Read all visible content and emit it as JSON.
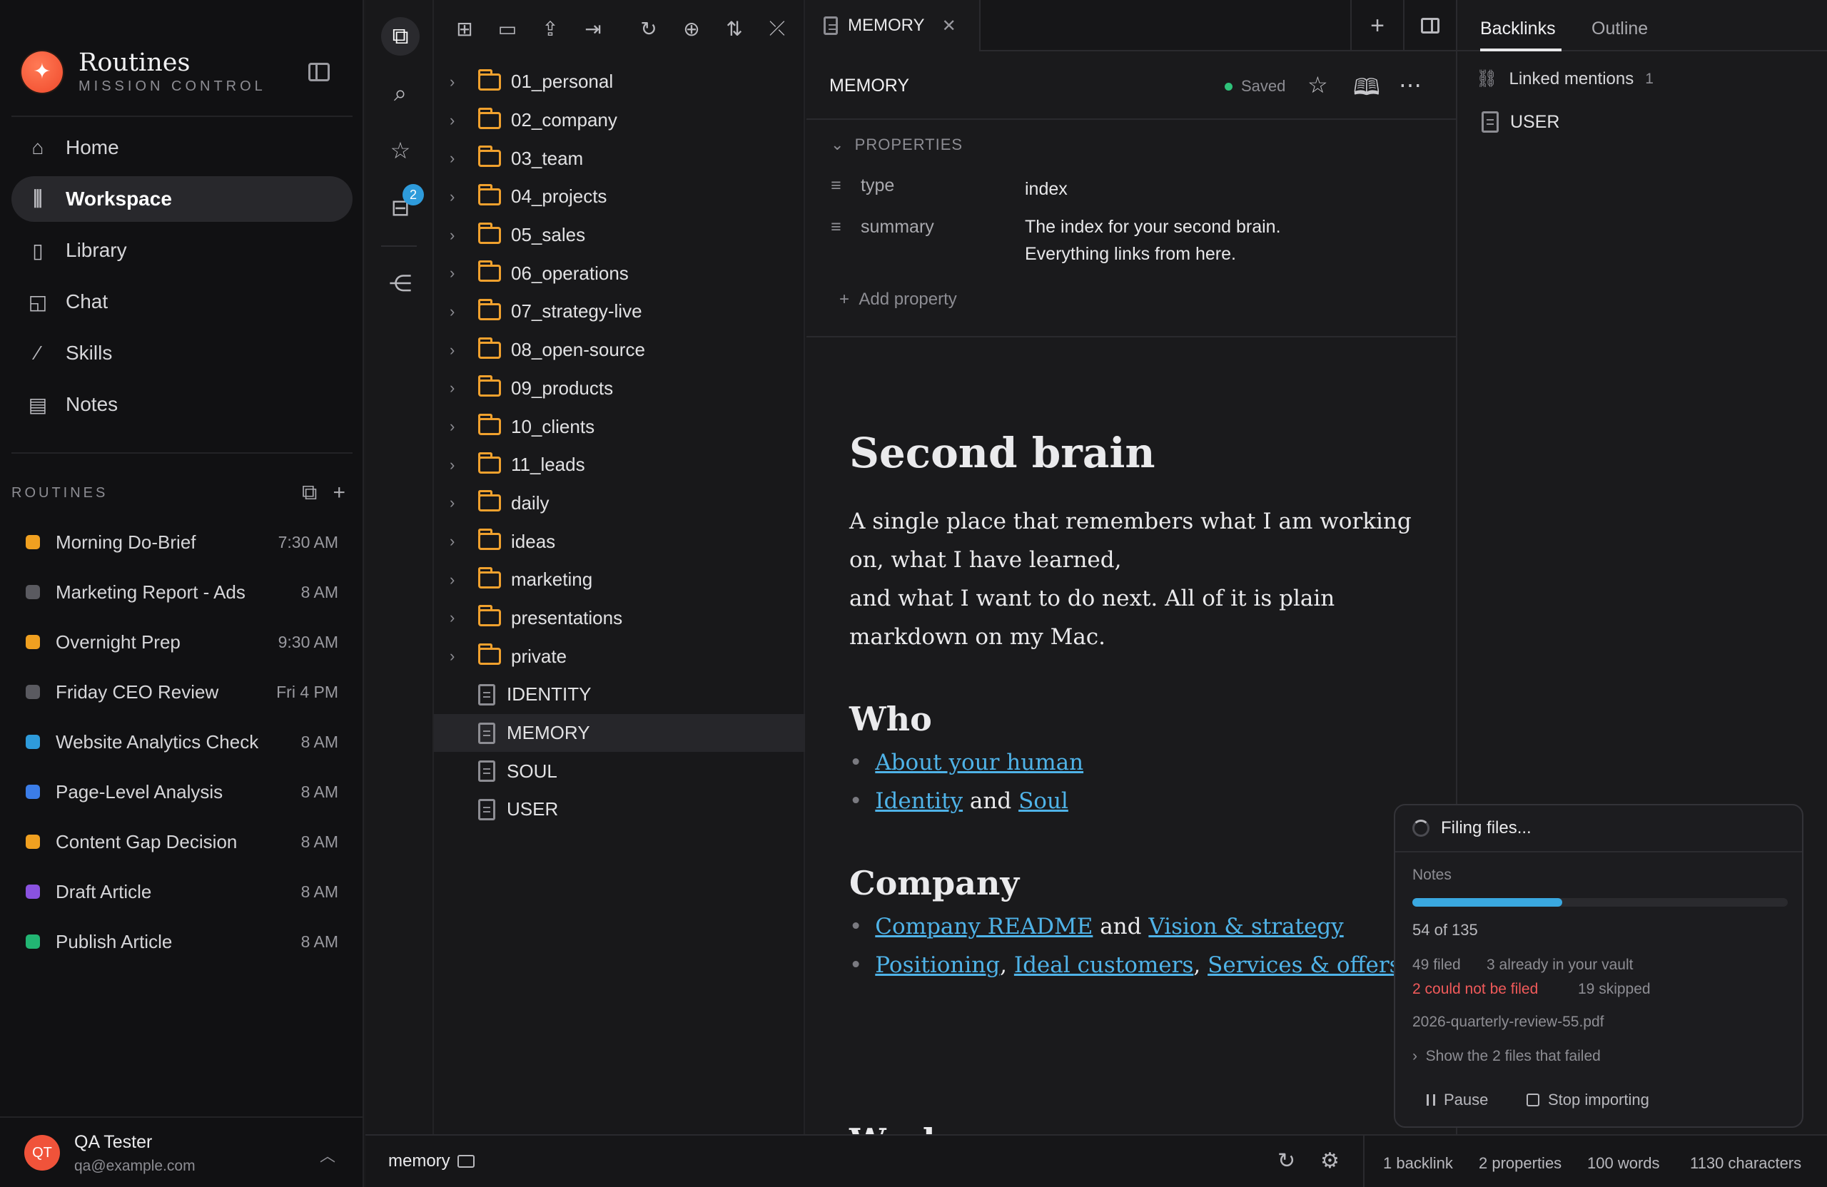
{
  "brand": {
    "title": "Routines",
    "subtitle": "MISSION CONTROL",
    "logo_icon": "sparkle-icon",
    "accent": "#f04a2c"
  },
  "nav": [
    {
      "label": "Home",
      "icon": "home-icon",
      "active": false
    },
    {
      "label": "Workspace",
      "icon": "library-icon",
      "active": true
    },
    {
      "label": "Library",
      "icon": "book-icon",
      "active": false
    },
    {
      "label": "Chat",
      "icon": "chat-icon",
      "active": false
    },
    {
      "label": "Skills",
      "icon": "wand-icon",
      "active": false
    },
    {
      "label": "Notes",
      "icon": "note-icon",
      "active": false
    }
  ],
  "routines": {
    "label": "ROUTINES",
    "items": [
      {
        "name": "Morning Do-Brief",
        "time": "7:30 AM",
        "color": "#f0a020"
      },
      {
        "name": "Marketing Report - Ads",
        "time": "8 AM",
        "color": "#5a5a60"
      },
      {
        "name": "Overnight Prep",
        "time": "9:30 AM",
        "color": "#f0a020"
      },
      {
        "name": "Friday CEO Review",
        "time": "Fri 4 PM",
        "color": "#5a5a60"
      },
      {
        "name": "Website Analytics Check",
        "time": "8 AM",
        "color": "#2e9bdb"
      },
      {
        "name": "Page-Level Analysis",
        "time": "8 AM",
        "color": "#3b7de8"
      },
      {
        "name": "Content Gap Decision",
        "time": "8 AM",
        "color": "#f0a020"
      },
      {
        "name": "Draft Article",
        "time": "8 AM",
        "color": "#8a52e0"
      },
      {
        "name": "Publish Article",
        "time": "8 AM",
        "color": "#22b573"
      }
    ]
  },
  "user": {
    "initials": "QT",
    "name": "QA Tester",
    "email": "qa@example.com"
  },
  "rail": {
    "inbox_badge": "2"
  },
  "tree": [
    {
      "name": "01_personal",
      "type": "folder"
    },
    {
      "name": "02_company",
      "type": "folder"
    },
    {
      "name": "03_team",
      "type": "folder"
    },
    {
      "name": "04_projects",
      "type": "folder"
    },
    {
      "name": "05_sales",
      "type": "folder"
    },
    {
      "name": "06_operations",
      "type": "folder"
    },
    {
      "name": "07_strategy-live",
      "type": "folder"
    },
    {
      "name": "08_open-source",
      "type": "folder"
    },
    {
      "name": "09_products",
      "type": "folder"
    },
    {
      "name": "10_clients",
      "type": "folder"
    },
    {
      "name": "11_leads",
      "type": "folder"
    },
    {
      "name": "daily",
      "type": "folder"
    },
    {
      "name": "ideas",
      "type": "folder"
    },
    {
      "name": "marketing",
      "type": "folder"
    },
    {
      "name": "presentations",
      "type": "folder"
    },
    {
      "name": "private",
      "type": "folder"
    },
    {
      "name": "IDENTITY",
      "type": "file"
    },
    {
      "name": "MEMORY",
      "type": "file",
      "selected": true
    },
    {
      "name": "SOUL",
      "type": "file"
    },
    {
      "name": "USER",
      "type": "file"
    }
  ],
  "editor": {
    "tab_label": "MEMORY",
    "doc_title": "MEMORY",
    "saved_label": "Saved",
    "properties_label": "PROPERTIES",
    "properties": [
      {
        "key": "type",
        "value": "index"
      },
      {
        "key": "summary",
        "value": "The index for your second brain. Everything links from here."
      }
    ],
    "add_property": "Add property",
    "h1": "Second brain",
    "intro_line1": "A single place that remembers what I am working on, what I have learned,",
    "intro_line2": "and what I want to do next. All of it is plain markdown on my Mac.",
    "who_heading": "Who",
    "who_link1": "About your human",
    "who_link2": "Identity",
    "who_and": "and",
    "who_link3": "Soul",
    "company_heading": "Company",
    "company_link1": "Company README",
    "company_and": "and",
    "company_link2": "Vision & strategy",
    "company_link3": "Positioning",
    "company_link4": "Ideal customers",
    "company_link5": "Services & offers",
    "next_heading": "Work"
  },
  "right_panel": {
    "tab_backlinks": "Backlinks",
    "tab_outline": "Outline",
    "linked_label": "Linked mentions",
    "linked_count": "1",
    "file": "USER"
  },
  "filing": {
    "title": "Filing files...",
    "label": "Notes",
    "progress": 0.4,
    "count": "54 of 135",
    "filed": "49 filed",
    "already": "3 already in your vault",
    "failed": "2 could not be filed",
    "skipped": "19 skipped",
    "current_file": "2026-quarterly-review-55.pdf",
    "show_failed": "Show the 2 files that failed",
    "pause": "Pause",
    "stop": "Stop importing"
  },
  "status": {
    "path": "memory",
    "backlinks": "1 backlink",
    "properties": "2 properties",
    "words": "100 words",
    "characters": "1130 characters"
  }
}
